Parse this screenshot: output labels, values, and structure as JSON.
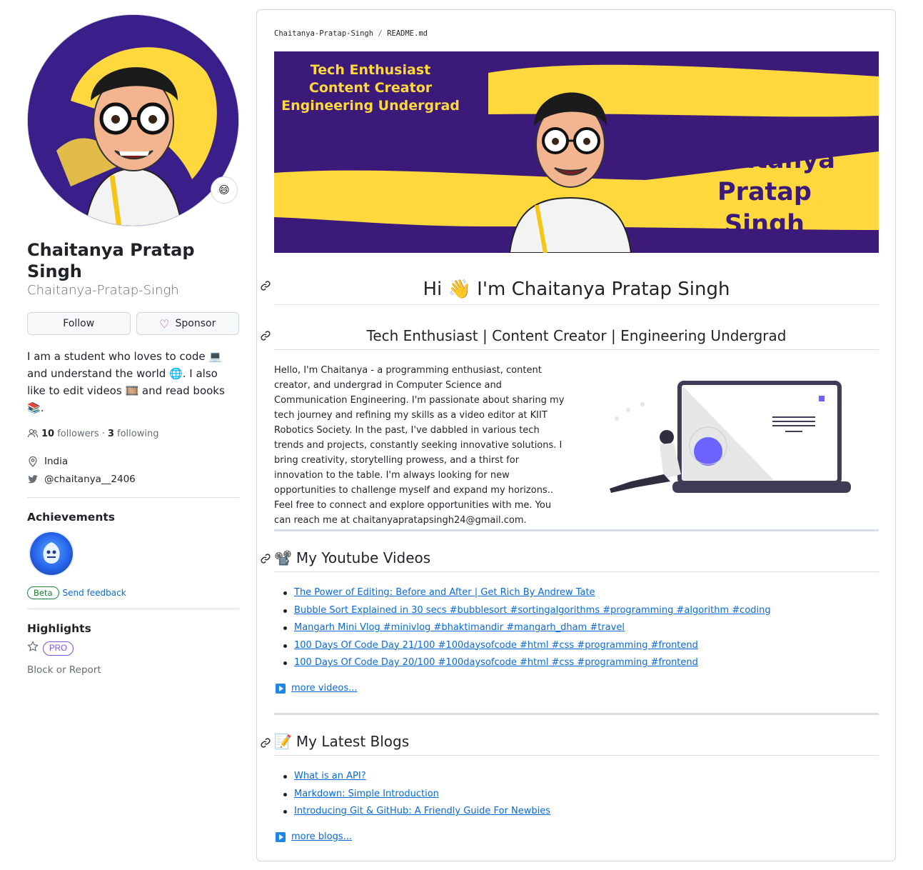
{
  "profile": {
    "status_emoji": "😄",
    "fullname": "Chaitanya Pratap Singh",
    "username": "Chaitanya-Pratap-Singh",
    "follow_label": "Follow",
    "sponsor_label": "Sponsor",
    "bio": {
      "part1": "I am a student who loves to code ",
      "emoji1": "💻",
      "part2": " and understand the world ",
      "emoji2": "🌐",
      "part3": ". I also like to edit videos ",
      "emoji3": "🎞️",
      "part4": " and read books ",
      "emoji4": "📚",
      "part5": "."
    },
    "followers_count": "10",
    "followers_label": "followers",
    "dot": "·",
    "following_count": "3",
    "following_label": "following",
    "location": "India",
    "twitter": "@chaitanya__2406"
  },
  "achievements": {
    "heading": "Achievements",
    "beta_label": "Beta",
    "feedback_label": "Send feedback"
  },
  "highlights": {
    "heading": "Highlights",
    "pro_label": "PRO",
    "block_label": "Block or Report"
  },
  "readme": {
    "breadcrumb_user": "Chaitanya-Pratap-Singh",
    "breadcrumb_sep": "/",
    "breadcrumb_file": "README.md",
    "banner": {
      "tag1": "Tech Enthusiast",
      "tag2": "Content Creator",
      "tag3": "Engineering Undergrad",
      "name1": "Chaitanya",
      "name2": "Pratap",
      "name3": "Singh"
    },
    "greeting_hi": "Hi",
    "greeting_emoji": "👋",
    "greeting_rest": "I'm Chaitanya Pratap Singh",
    "tagline": "Tech Enthusiast | Content Creator | Engineering Undergrad",
    "intro": "Hello, I'm Chaitanya - a programming enthusiast, content creator, and undergrad in Computer Science and Communication Engineering. I'm passionate about sharing my tech journey and refining my skills as a video editor at KIIT Robotics Society. In the past, I've dabbled in various tech trends and projects, constantly seeking innovative solutions. I bring creativity, storytelling prowess, and a thirst for innovation to the table. I'm always looking for new opportunities to challenge myself and expand my horizons.. Feel free to connect and explore opportunities with me. You can reach me at chaitanyapratapsingh24@gmail.com.",
    "videos_emoji": "📽️",
    "videos_heading": "My Youtube Videos",
    "videos": [
      "The Power of Editing: Before and After | Get Rich By Andrew Tate",
      "Bubble Sort Explained in 30 secs #bubblesort #sortingalgorithms #programming #algorithm #coding",
      "Mangarh Mini Vlog #minivlog #bhaktimandir #mangarh_dham #travel",
      "100 Days Of Code Day 21/100 #100daysofcode #html #css #programming #frontend",
      "100 Days Of Code Day 20/100 #100daysofcode #html #css #programming #frontend"
    ],
    "more_videos": "more videos...",
    "blogs_emoji": "📝",
    "blogs_heading": "My Latest Blogs",
    "blogs": [
      "What is an API?",
      "Markdown: Simple Introduction",
      "Introducing Git & GitHub: A Friendly Guide For Newbies"
    ],
    "more_blogs": "more blogs..."
  },
  "colors": {
    "link": "#0969da",
    "banner_purple": "#3b1a7a",
    "banner_yellow": "#ffd83d",
    "pro": "#8250df",
    "beta": "#1a7f37"
  },
  "icons": [
    "people-icon",
    "location-icon",
    "twitter-icon",
    "heart-icon",
    "link-icon",
    "star-icon",
    "play-icon"
  ]
}
